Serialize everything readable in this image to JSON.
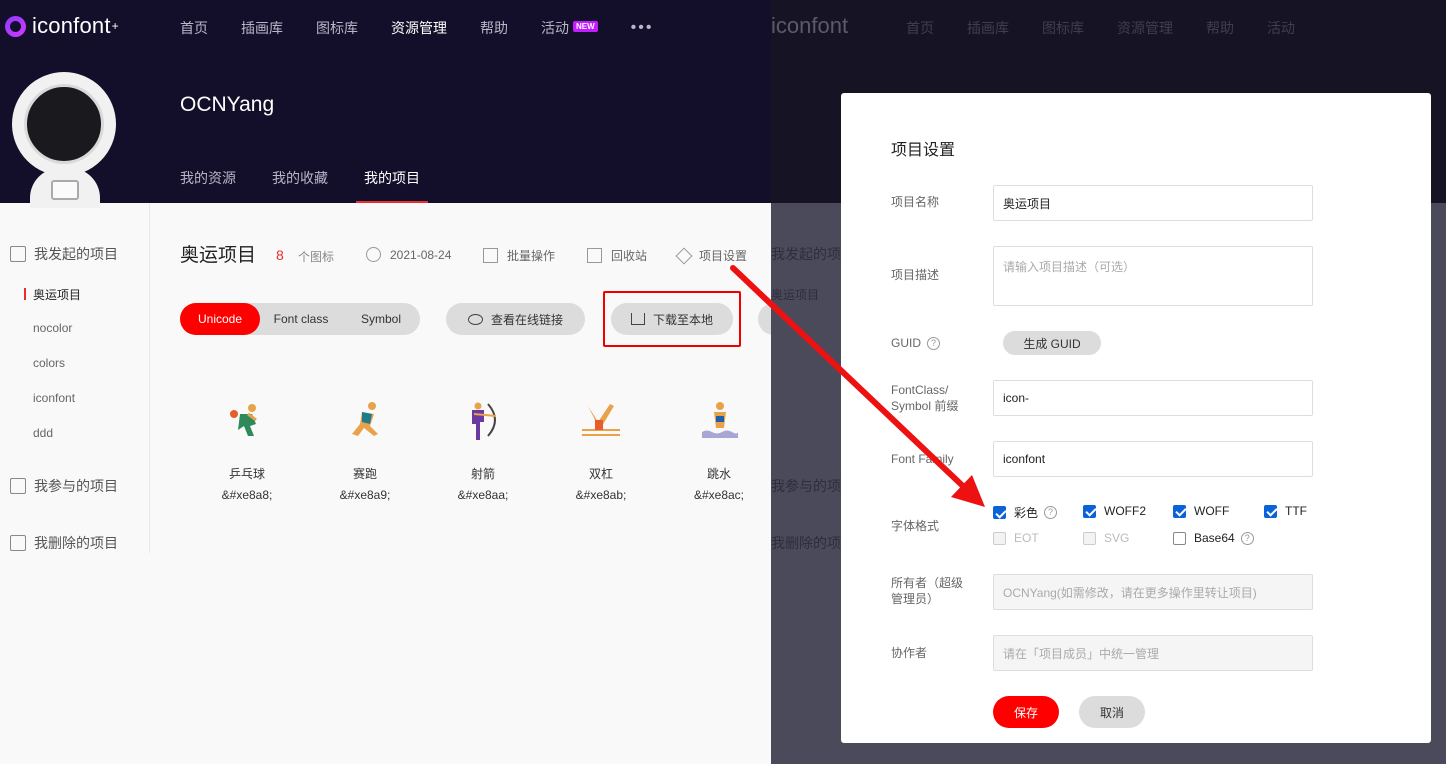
{
  "nav": {
    "logo": "iconfont",
    "items": [
      "首页",
      "插画库",
      "图标库",
      "资源管理",
      "帮助",
      "活动"
    ],
    "new_badge": "NEW",
    "more": "•••"
  },
  "profile": {
    "username": "OCNYang",
    "tabs": [
      "我的资源",
      "我的收藏",
      "我的项目"
    ]
  },
  "sidebar": {
    "group_started": "我发起的项目",
    "projects": [
      "奥运项目",
      "nocolor",
      "colors",
      "iconfont",
      "ddd"
    ],
    "group_joined": "我参与的项目",
    "group_deleted": "我删除的项目"
  },
  "project": {
    "title": "奥运项目",
    "count": "8",
    "count_label": "个图标",
    "date": "2021-08-24",
    "batch": "批量操作",
    "recycle": "回收站",
    "settings": "项目设置"
  },
  "toolbar": {
    "modes": [
      "Unicode",
      "Font class",
      "Symbol"
    ],
    "view_link": "查看在线链接",
    "download": "下载至本地"
  },
  "icons": [
    {
      "name": "乒乓球",
      "code": "&#xe8a8;"
    },
    {
      "name": "赛跑",
      "code": "&#xe8a9;"
    },
    {
      "name": "射箭",
      "code": "&#xe8aa;"
    },
    {
      "name": "双杠",
      "code": "&#xe8ab;"
    },
    {
      "name": "跳水",
      "code": "&#xe8ac;"
    }
  ],
  "modal": {
    "title": "项目设置",
    "name_label": "项目名称",
    "name_value": "奥运项目",
    "desc_label": "项目描述",
    "desc_placeholder": "请输入项目描述（可选）",
    "guid_label": "GUID",
    "guid_button": "生成 GUID",
    "prefix_label_1": "FontClass/",
    "prefix_label_2": "Symbol 前缀",
    "prefix_value": "icon-",
    "family_label": "Font Family",
    "family_value": "iconfont",
    "format_label": "字体格式",
    "formats": {
      "color": "彩色",
      "woff2": "WOFF2",
      "woff": "WOFF",
      "ttf": "TTF",
      "eot": "EOT",
      "svg": "SVG",
      "base64": "Base64"
    },
    "owner_label_1": "所有者（超级",
    "owner_label_2": "管理员）",
    "owner_value": "OCNYang(如需修改，请在更多操作里转让项目)",
    "collab_label": "协作者",
    "collab_value": "请在「项目成员」中统一管理",
    "save": "保存",
    "cancel": "取消"
  },
  "colors": {
    "accent": "#ff0000",
    "dark_header": "#130f2a",
    "checkbox": "#0a64d8"
  }
}
